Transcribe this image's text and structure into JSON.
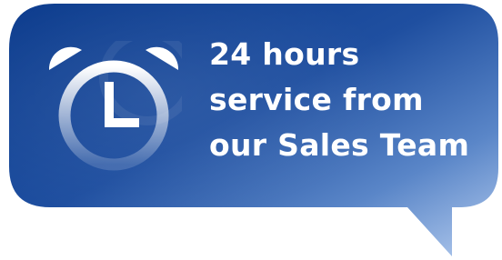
{
  "bubble": {
    "message_lines": [
      "24 hours",
      "service from",
      "our Sales Team"
    ]
  },
  "icons": {
    "clock": "alarm-clock-icon"
  },
  "colors": {
    "bubble_dark": "#0a3a8c",
    "bubble_mid": "#2f5fae",
    "bubble_light": "#a9c4ea",
    "text": "#ffffff"
  }
}
